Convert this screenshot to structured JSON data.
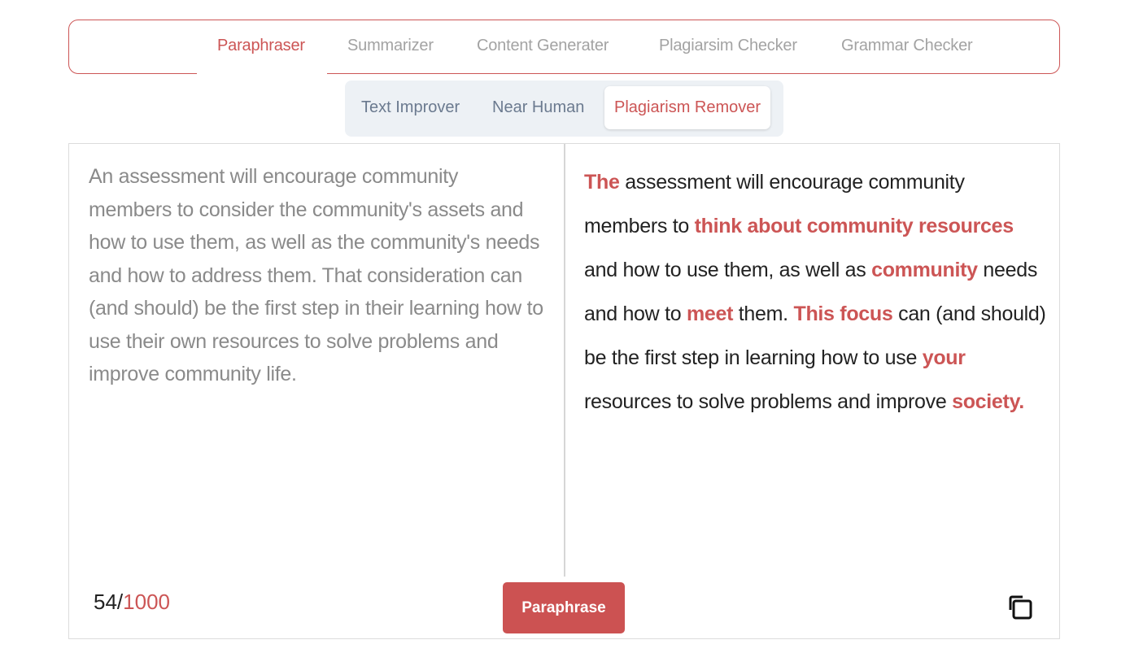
{
  "top_nav": {
    "tabs": [
      {
        "label": "Paraphraser",
        "active": true
      },
      {
        "label": "Summarizer",
        "active": false
      },
      {
        "label": "Content Generater",
        "active": false
      },
      {
        "label": "Plagiarsim Checker",
        "active": false
      },
      {
        "label": "Grammar Checker",
        "active": false
      }
    ]
  },
  "mode_tabs": {
    "tabs": [
      {
        "label": "Text Improver",
        "active": false
      },
      {
        "label": "Near Human",
        "active": false
      },
      {
        "label": "Plagiarism Remover",
        "active": true
      }
    ]
  },
  "input": {
    "text": "An assessment will encourage community members to consider the community's assets and how to use them, as well as the community's needs and how to address them. That consideration can (and should) be the first step in their learning how to use their own resources to solve problems and improve community life."
  },
  "output": {
    "segments": [
      {
        "text": "The",
        "changed": true
      },
      {
        "text": " assessment will encourage community members to ",
        "changed": false
      },
      {
        "text": "think about community resources",
        "changed": true
      },
      {
        "text": " and how to use them, as well as ",
        "changed": false
      },
      {
        "text": "community",
        "changed": true
      },
      {
        "text": " needs and how to ",
        "changed": false
      },
      {
        "text": "meet",
        "changed": true
      },
      {
        "text": " them. ",
        "changed": false
      },
      {
        "text": "This focus",
        "changed": true
      },
      {
        "text": " can (and should) be the first step in learning how to use ",
        "changed": false
      },
      {
        "text": "your",
        "changed": true
      },
      {
        "text": " resources to solve problems and improve ",
        "changed": false
      },
      {
        "text": "society.",
        "changed": true
      }
    ]
  },
  "footer": {
    "word_count": "54",
    "separator": "/",
    "word_limit": "1000",
    "paraphrase_label": "Paraphrase",
    "copy_icon": "copy-icon"
  },
  "colors": {
    "accent": "#cc5555",
    "inactive_tab": "#a3a3a3",
    "mode_tab": "#6b7a8f",
    "mode_bar_bg": "#edf1f5"
  }
}
